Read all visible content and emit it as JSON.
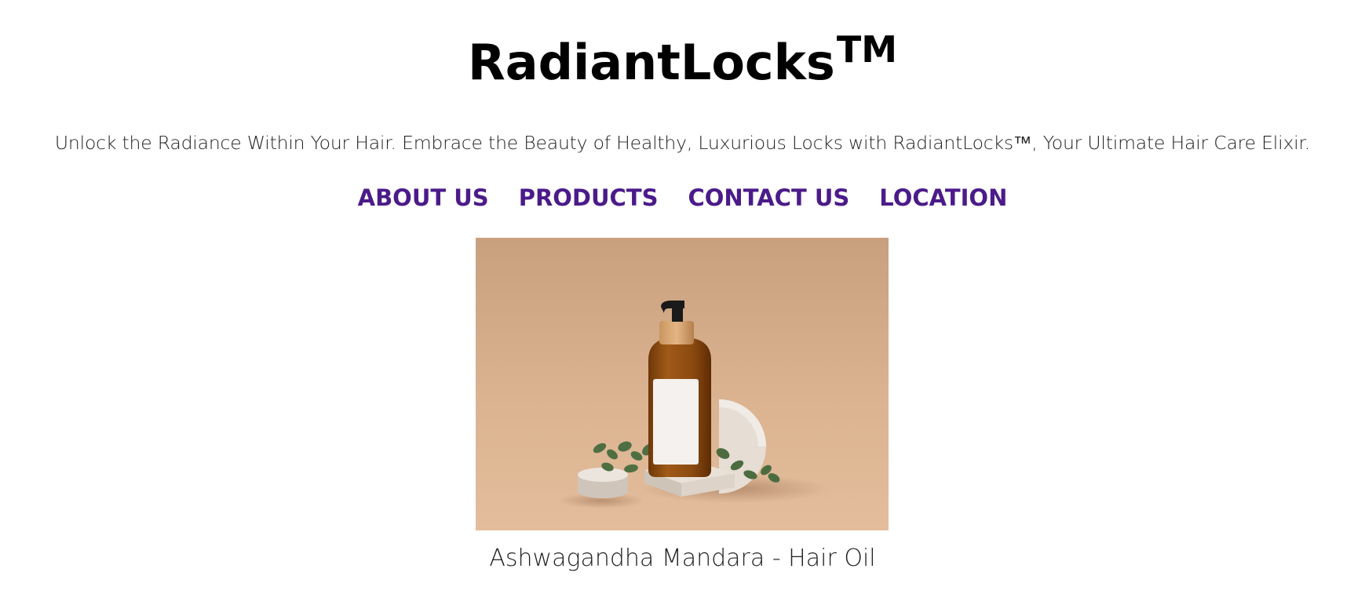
{
  "header": {
    "brand": "RadiantLocks",
    "brand_mark": "TM",
    "tagline": "Unlock the Radiance Within Your Hair. Embrace the Beauty of Healthy, Luxurious Locks with RadiantLocks™, Your Ultimate Hair Care Elixir."
  },
  "nav": {
    "items": [
      {
        "label": "ABOUT US"
      },
      {
        "label": "PRODUCTS"
      },
      {
        "label": "CONTACT US"
      },
      {
        "label": "LOCATION"
      }
    ]
  },
  "product": {
    "image_icon": "hair-oil-bottle-photo",
    "caption": "Ashwagandha Mandara - Hair Oil"
  },
  "colors": {
    "nav": "#4b1b8a",
    "photo_background": "#d9ad8b",
    "oil_bottle": "#8b4a12"
  }
}
